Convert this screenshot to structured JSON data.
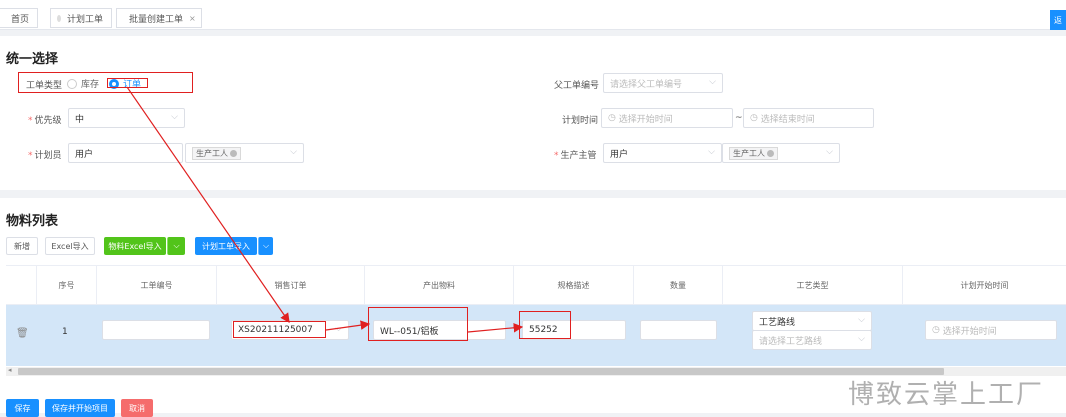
{
  "tabs": [
    {
      "label": "首页"
    },
    {
      "label": "计划工单"
    },
    {
      "label": "批量创建工单",
      "close": "×"
    }
  ],
  "corner_button": "返",
  "section1": {
    "title": "统一选择",
    "work_type": {
      "label": "工单类型",
      "options": [
        "库存",
        "订单"
      ],
      "selected": "订单"
    },
    "parent_order": {
      "label": "父工单编号",
      "placeholder": "请选择父工单编号"
    },
    "priority": {
      "label": "优先级",
      "value": "中"
    },
    "plan_time": {
      "label": "计划时间",
      "start_placeholder": "选择开始时间",
      "sep": "~",
      "end_placeholder": "选择结束时间"
    },
    "planner": {
      "label": "计划员",
      "value": "用户",
      "tag": "生产工人"
    },
    "supervisor": {
      "label": "生产主管",
      "value": "用户",
      "tag": "生产工人"
    }
  },
  "section2": {
    "title": "物料列表",
    "buttons": {
      "add": "新增",
      "excel_import": "Excel导入",
      "material_excel": "物料Excel导入",
      "plan_import": "计划工单导入"
    },
    "columns": [
      "序号",
      "工单编号",
      "销售订单",
      "产出物料",
      "规格描述",
      "数量",
      "工艺类型",
      "计划开始时间"
    ],
    "row": {
      "index": "1",
      "order_no": "",
      "sales_order": "XS20211125007",
      "material": "WL--051/铝板",
      "spec": "55252",
      "quantity": "",
      "process_type": "工艺路线",
      "process_route_placeholder": "请选择工艺路线",
      "start_placeholder": "选择开始时间"
    }
  },
  "footer": {
    "save": "保存",
    "save_start": "保存并开始项目",
    "cancel": "取消"
  },
  "watermark": "博致云掌上工厂",
  "colors": {
    "primary": "#1890ff",
    "green": "#52c41a",
    "danger": "#f56c6c",
    "annotation": "#e02020"
  }
}
